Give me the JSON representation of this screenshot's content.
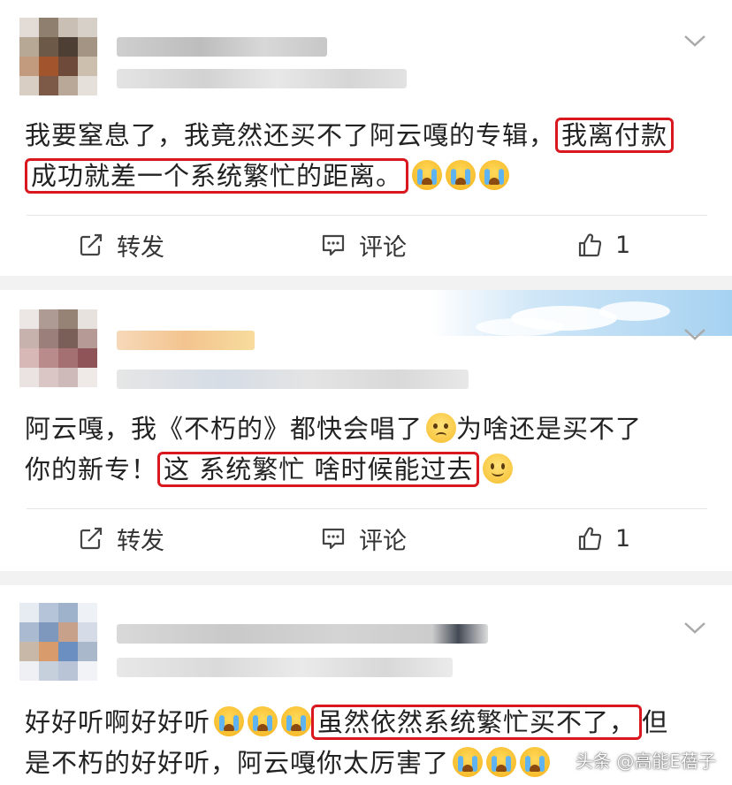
{
  "posts": [
    {
      "text_line1_plain": "我要窒息了，我竟然还买不了阿云嘎的专辑，",
      "text_line1_hl": "我离付款",
      "text_line2_hl": "成功就差一个系统繁忙的距离。",
      "repost_label": "转发",
      "comment_label": "评论",
      "like_count": "1",
      "emojis": [
        "crying-face",
        "crying-face",
        "crying-face"
      ]
    },
    {
      "text_line1_plain_a": "阿云嘎，我《不朽的》都快会唱了",
      "text_line1_plain_b": "为啥还是买不了",
      "text_line2_plain": "你的新专！",
      "text_line2_hl": "这 系统繁忙 啥时候能过去",
      "repost_label": "转发",
      "comment_label": "评论",
      "like_count": "1",
      "emojis": [
        "worried-face",
        "smiling-face"
      ]
    },
    {
      "text_line1_plain": "好好听啊好好听",
      "text_line1_hl": "虽然依然系统繁忙买不了，",
      "text_line1_tail": "但",
      "text_line2_plain": "是不朽的好好听，阿云嘎你太厉害了",
      "emojis": [
        "crying-face",
        "crying-face",
        "crying-face",
        "crying-face",
        "crying-face",
        "crying-face"
      ]
    }
  ],
  "watermark": "头条 @高能E蓓子",
  "colors": {
    "highlight_border": "#d8181e",
    "separator": "#f2f2f2",
    "divider": "#e6e6e6"
  },
  "icons": {
    "repost": "edit-square-icon",
    "comment": "comment-bubble-icon",
    "like": "thumbs-up-icon",
    "menu": "chevron-down-icon"
  }
}
